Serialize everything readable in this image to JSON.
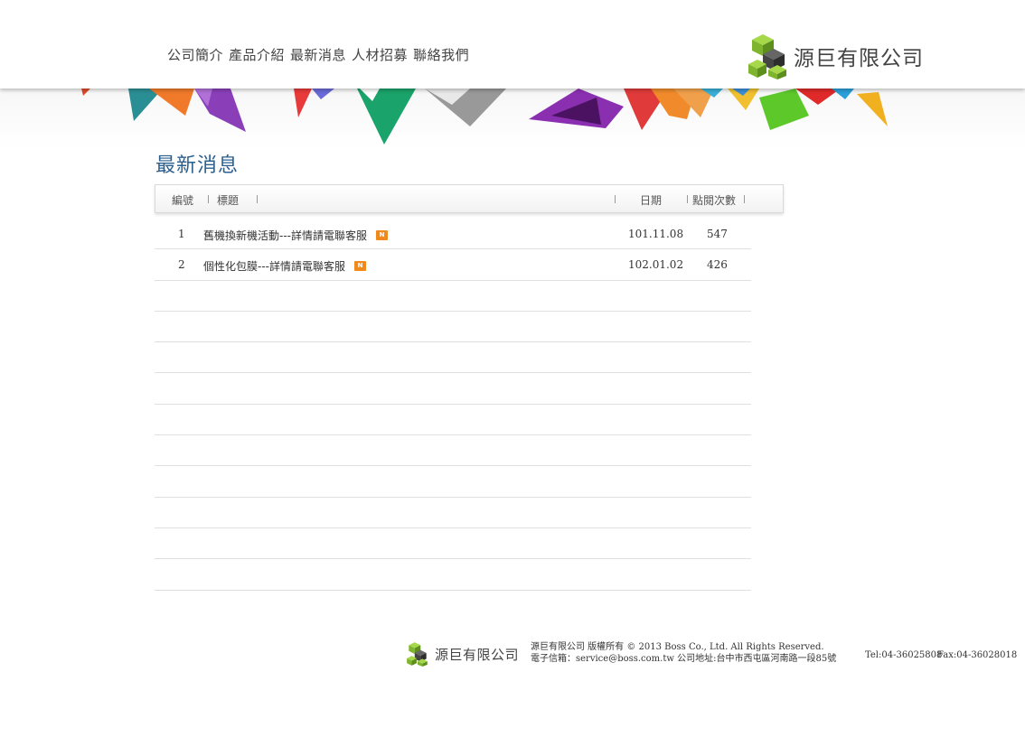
{
  "nav": {
    "items": [
      {
        "label": "公司簡介"
      },
      {
        "label": "產品介紹"
      },
      {
        "label": "最新消息"
      },
      {
        "label": "人材招募"
      },
      {
        "label": "聯絡我們"
      }
    ]
  },
  "brand": {
    "name": "源巨有限公司"
  },
  "section": {
    "title": "最新消息"
  },
  "table": {
    "headers": {
      "number": "編號",
      "title": "標題",
      "date": "日期",
      "views": "點閱次數"
    },
    "rows": [
      {
        "number": "1",
        "title": "舊機換新機活動---詳情請電聯客服",
        "date": "101.11.08",
        "views": "547",
        "icon": "new-icon"
      },
      {
        "number": "2",
        "title": "個性化包膜---詳情請電聯客服",
        "date": "102.01.02",
        "views": "426",
        "icon": "new-icon"
      }
    ]
  },
  "footer": {
    "brand_name": "源巨有限公司",
    "copyright": "源巨有限公司 版權所有 © 2013  Boss Co., Ltd. All Rights Reserved.",
    "contact": "電子信箱：service@boss.com.tw    公司地址:台中市西屯區河南路一段85號",
    "tel": "Tel:04-36025808",
    "fax": "Fax:04-36028018"
  },
  "colors": {
    "title_blue": "#2a5f8f",
    "new_badge": "#f08a1d",
    "logo_green": "#8dc63f",
    "logo_dark": "#3a3a3a"
  }
}
